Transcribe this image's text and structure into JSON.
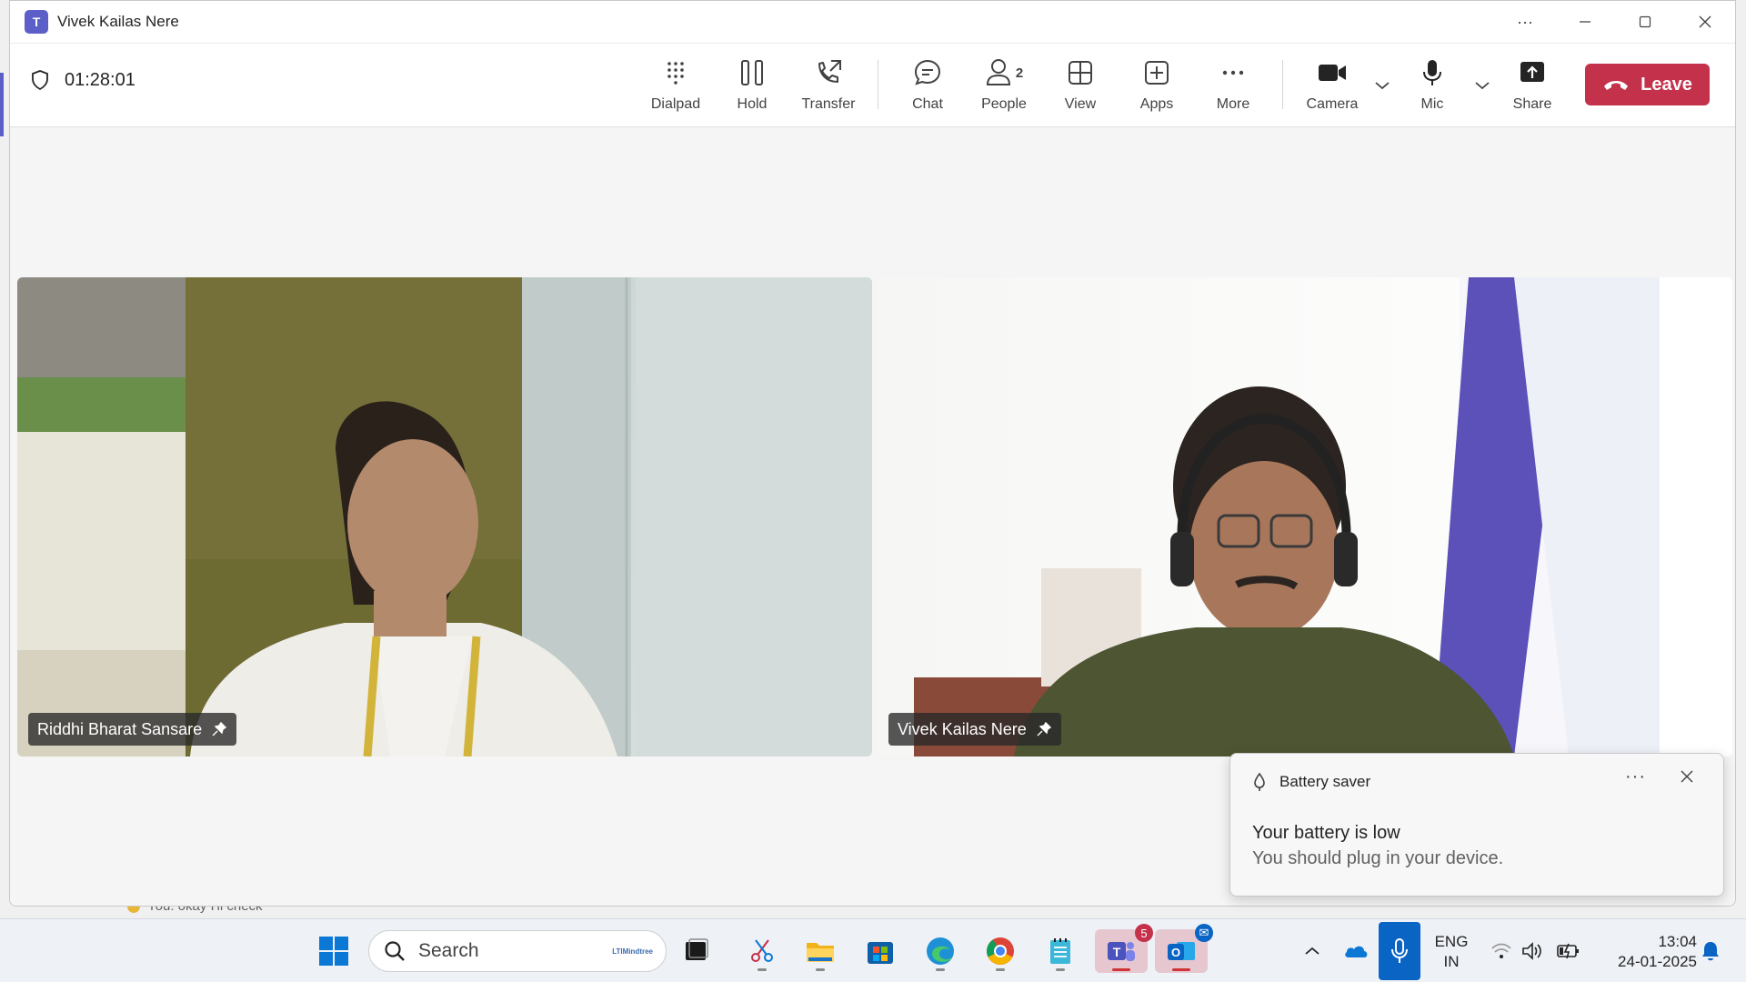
{
  "window": {
    "title": "Vivek Kailas Nere",
    "more_label": "···"
  },
  "call": {
    "duration": "01:28:01"
  },
  "toolbar": {
    "dialpad": "Dialpad",
    "hold": "Hold",
    "transfer": "Transfer",
    "chat": "Chat",
    "people": "People",
    "people_count": "2",
    "view": "View",
    "apps": "Apps",
    "more": "More",
    "camera": "Camera",
    "mic": "Mic",
    "share": "Share",
    "leave": "Leave"
  },
  "participants": [
    {
      "name": "Riddhi Bharat Sansare"
    },
    {
      "name": "Vivek Kailas Nere"
    }
  ],
  "toast": {
    "app": "Battery saver",
    "title": "Your battery is low",
    "body": "You should plug in your device."
  },
  "background_chat": {
    "preview": "You: okay I'll check"
  },
  "taskbar": {
    "search_placeholder": "Search",
    "search_brand": "LTIMindtree",
    "teams_badge": "5",
    "lang_top": "ENG",
    "lang_bottom": "IN",
    "time": "13:04",
    "date": "24-01-2025"
  },
  "colors": {
    "accent": "#5b5fc7",
    "leave": "#c4314b"
  }
}
